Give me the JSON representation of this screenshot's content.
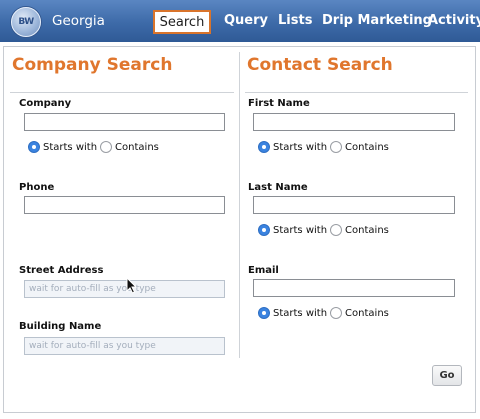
{
  "nav": {
    "logo_text": "BW",
    "brand": "Georgia",
    "tabs": [
      {
        "label": "Search"
      },
      {
        "label": "Query"
      },
      {
        "label": "Lists"
      },
      {
        "label": "Drip Marketing"
      },
      {
        "label": "Activity M"
      }
    ]
  },
  "company_search": {
    "title": "Company Search",
    "company": {
      "label": "Company",
      "value": ""
    },
    "company_match": {
      "starts_with": "Starts with",
      "contains": "Contains",
      "selected": "starts_with"
    },
    "phone": {
      "label": "Phone",
      "value": ""
    },
    "street_address": {
      "label": "Street Address",
      "placeholder": "wait for auto-fill as you type"
    },
    "building_name": {
      "label": "Building Name",
      "placeholder": "wait for auto-fill as you type"
    }
  },
  "contact_search": {
    "title": "Contact Search",
    "first_name": {
      "label": "First Name",
      "value": ""
    },
    "first_name_match": {
      "starts_with": "Starts with",
      "contains": "Contains",
      "selected": "starts_with"
    },
    "last_name": {
      "label": "Last Name",
      "value": ""
    },
    "last_name_match": {
      "starts_with": "Starts with",
      "contains": "Contains",
      "selected": "starts_with"
    },
    "email": {
      "label": "Email",
      "value": ""
    },
    "email_match": {
      "starts_with": "Starts with",
      "contains": "Contains",
      "selected": "starts_with"
    }
  },
  "actions": {
    "go_label": "Go"
  },
  "colors": {
    "accent_orange": "#e0762d",
    "nav_blue": "#3d6aa8",
    "radio_blue": "#3a83e0"
  }
}
